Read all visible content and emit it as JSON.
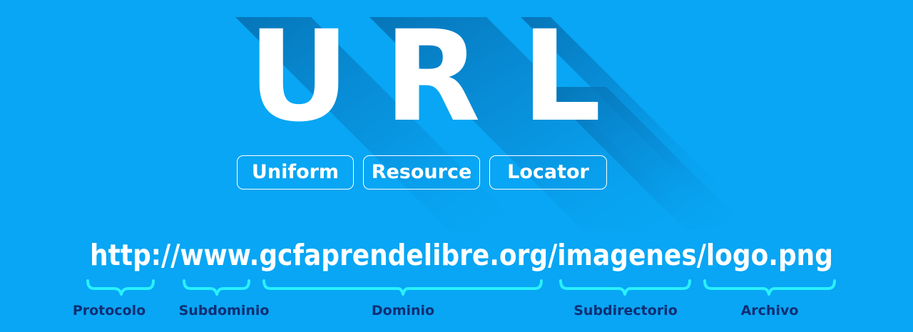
{
  "title": {
    "letters": [
      "U",
      "R",
      "L"
    ]
  },
  "expansion": [
    "Uniform",
    "Resource",
    "Locator"
  ],
  "url": {
    "segments": [
      {
        "text": "http://",
        "part": "Protocolo"
      },
      {
        "text": "www.",
        "part": "Subdominio"
      },
      {
        "text": "gcfaprendelibre.org/",
        "part": "Dominio"
      },
      {
        "text": "imagenes/",
        "part": "Subdirectorio"
      },
      {
        "text": "logo.png",
        "part": "Archivo"
      }
    ]
  },
  "parts": [
    "Protocolo",
    "Subdominio",
    "Dominio",
    "Subdirectorio",
    "Archivo"
  ],
  "colors": {
    "background": "#08a6f4",
    "letter_fill": "#ffffff",
    "letter_shadow": "#0579bd",
    "brace": "#29f0ff",
    "part_label": "#102e73",
    "url_text": "#ffffff"
  }
}
